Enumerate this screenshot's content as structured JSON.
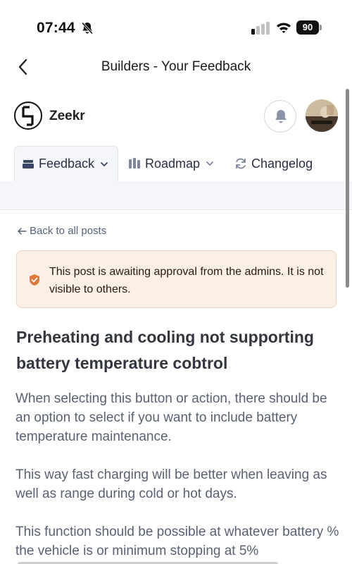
{
  "status_bar": {
    "time": "07:44",
    "battery": "90",
    "icons": [
      "bell-slash-icon",
      "signal-icon",
      "wifi-icon",
      "battery-icon"
    ]
  },
  "header": {
    "title": "Builders - Your Feedback",
    "back_icon": "chevron-left-icon"
  },
  "brand": {
    "name": "Zeekr",
    "notification_icon": "bell-icon"
  },
  "tabs": [
    {
      "label": "Feedback",
      "icon": "inbox-icon",
      "active": true,
      "has_dropdown": true
    },
    {
      "label": "Roadmap",
      "icon": "roadmap-icon",
      "active": false,
      "has_dropdown": true
    },
    {
      "label": "Changelog",
      "icon": "refresh-icon",
      "active": false,
      "has_dropdown": false
    }
  ],
  "content": {
    "back_link": "Back to all posts",
    "alert": {
      "text": "This post is awaiting approval from the admins. It is not visible to others.",
      "icon": "shield-check-icon"
    },
    "post": {
      "title": "Preheating and cooling not supporting battery temperature cobtrol",
      "paragraphs": [
        "When selecting this button or action, there should be an option to select if you want to include battery temperature maintenance.",
        "This way fast charging will be better when leaving as well as range during cold or hot days.",
        "This function should be possible at whatever battery % the vehicle is or minimum stopping at 5%"
      ]
    }
  },
  "colors": {
    "alert_background": "#fcefe6",
    "alert_border": "#f3d3bd",
    "alert_icon": "#e0793a",
    "tab_active_background": "#f5f6f9",
    "link_text": "#55607a"
  }
}
